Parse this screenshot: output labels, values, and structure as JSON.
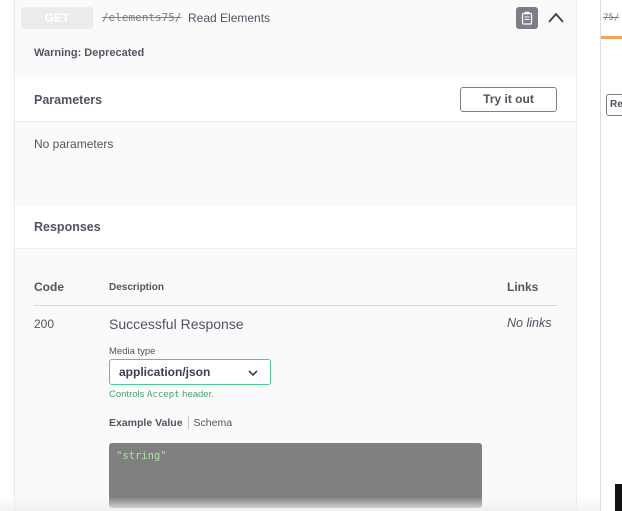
{
  "operation": {
    "method": "GET",
    "path": "/elements75/",
    "description": "Read Elements",
    "warning": "Warning: Deprecated"
  },
  "parameters": {
    "title": "Parameters",
    "try_button": "Try it out",
    "empty_text": "No parameters"
  },
  "responses": {
    "title": "Responses",
    "columns": {
      "code": "Code",
      "description": "Description",
      "links": "Links"
    },
    "rows": [
      {
        "code": "200",
        "description": "Successful Response",
        "links": "No links",
        "media_type_label": "Media type",
        "media_type": "application/json",
        "controls_text": "Controls ",
        "controls_code": "Accept",
        "controls_suffix": " header.",
        "example_value_tab": "Example Value",
        "schema_tab": "Schema",
        "example": "\"string\""
      }
    ]
  },
  "side_panel": {
    "path_fragment": "75/",
    "button_fragment": "Rea"
  },
  "colors": {
    "select_border": "#49cc90",
    "controls_text": "#49a16e",
    "example_bg": "#808080",
    "example_text": "#a8e6a0",
    "accent_bar": "#f5a25a"
  },
  "icons": [
    "copy-icon",
    "chevron-up-icon",
    "chevron-down-icon"
  ]
}
